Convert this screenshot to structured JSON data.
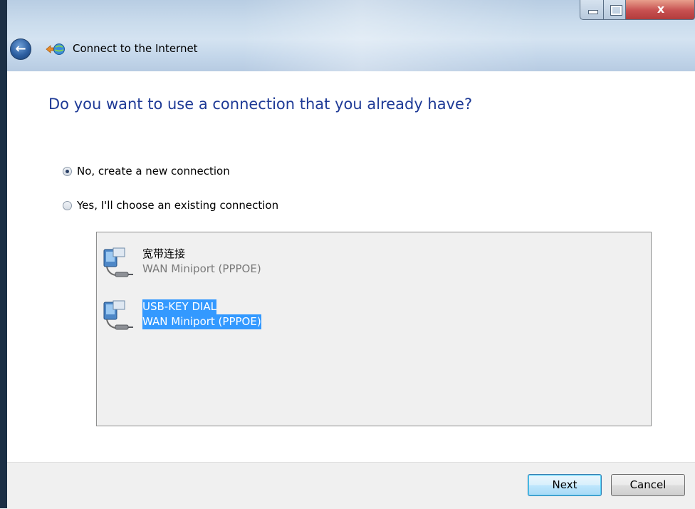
{
  "window": {
    "title": "Connect to the Internet",
    "close_glyph": "x"
  },
  "heading": "Do you want to use a connection that you already have?",
  "options": {
    "no_label": "No, create a new connection",
    "yes_label": "Yes, I'll choose an existing connection",
    "selected": "no"
  },
  "connections": [
    {
      "name": "宽带连接",
      "device": "WAN Miniport (PPPOE)",
      "selected": false,
      "icon": "network-connection-icon"
    },
    {
      "name": "USB-KEY DIAL",
      "device": "WAN Miniport (PPPOE)",
      "selected": true,
      "icon": "network-connection-icon"
    }
  ],
  "buttons": {
    "next": "Next",
    "cancel": "Cancel"
  },
  "colors": {
    "heading": "#1e3a96",
    "selection": "#3399ff",
    "close_button": "#c75050"
  }
}
